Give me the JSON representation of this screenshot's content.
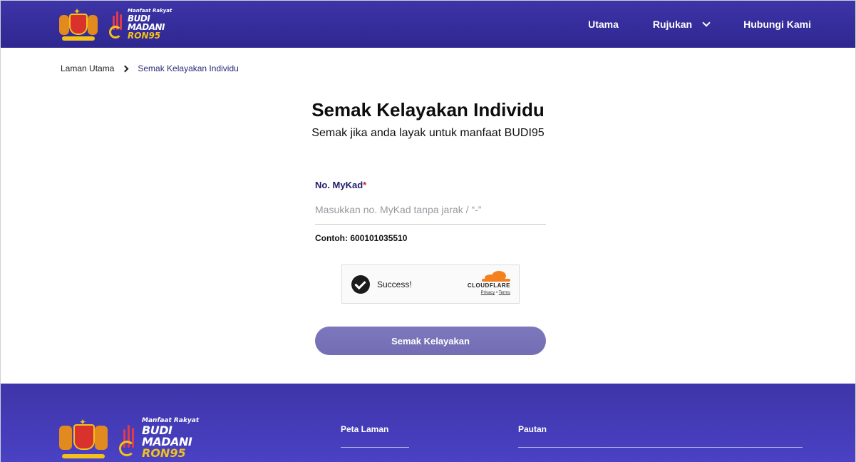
{
  "header": {
    "logo_small": "Manfaat Rakyat",
    "logo_budi": "BUDI",
    "logo_madani": "MADANI",
    "logo_ron": "RON95",
    "nav": {
      "utama": "Utama",
      "rujukan": "Rujukan",
      "hubungi": "Hubungi Kami"
    }
  },
  "breadcrumb": {
    "home": "Laman Utama",
    "current": "Semak Kelayakan Individu"
  },
  "page": {
    "title": "Semak Kelayakan Individu",
    "subtitle": "Semak jika anda layak untuk manfaat BUDI95"
  },
  "form": {
    "label": "No. MyKad",
    "required_mark": "*",
    "placeholder": "Masukkan no. MyKad tanpa jarak / “-”",
    "value": "",
    "example": "Contoh: 600101035510",
    "submit_label": "Semak Kelayakan"
  },
  "captcha": {
    "status": "Success!",
    "provider": "CLOUDFLARE",
    "privacy": "Privacy",
    "separator": "•",
    "terms": "Terms"
  },
  "footer": {
    "col1": "Peta Laman",
    "col2": "Pautan"
  },
  "colors": {
    "header_bg": "#3d34a8",
    "button_bg": "#7a75ba",
    "accent_text": "#1f1d6b",
    "required": "#d1203a",
    "cloudflare_orange": "#f48120"
  }
}
